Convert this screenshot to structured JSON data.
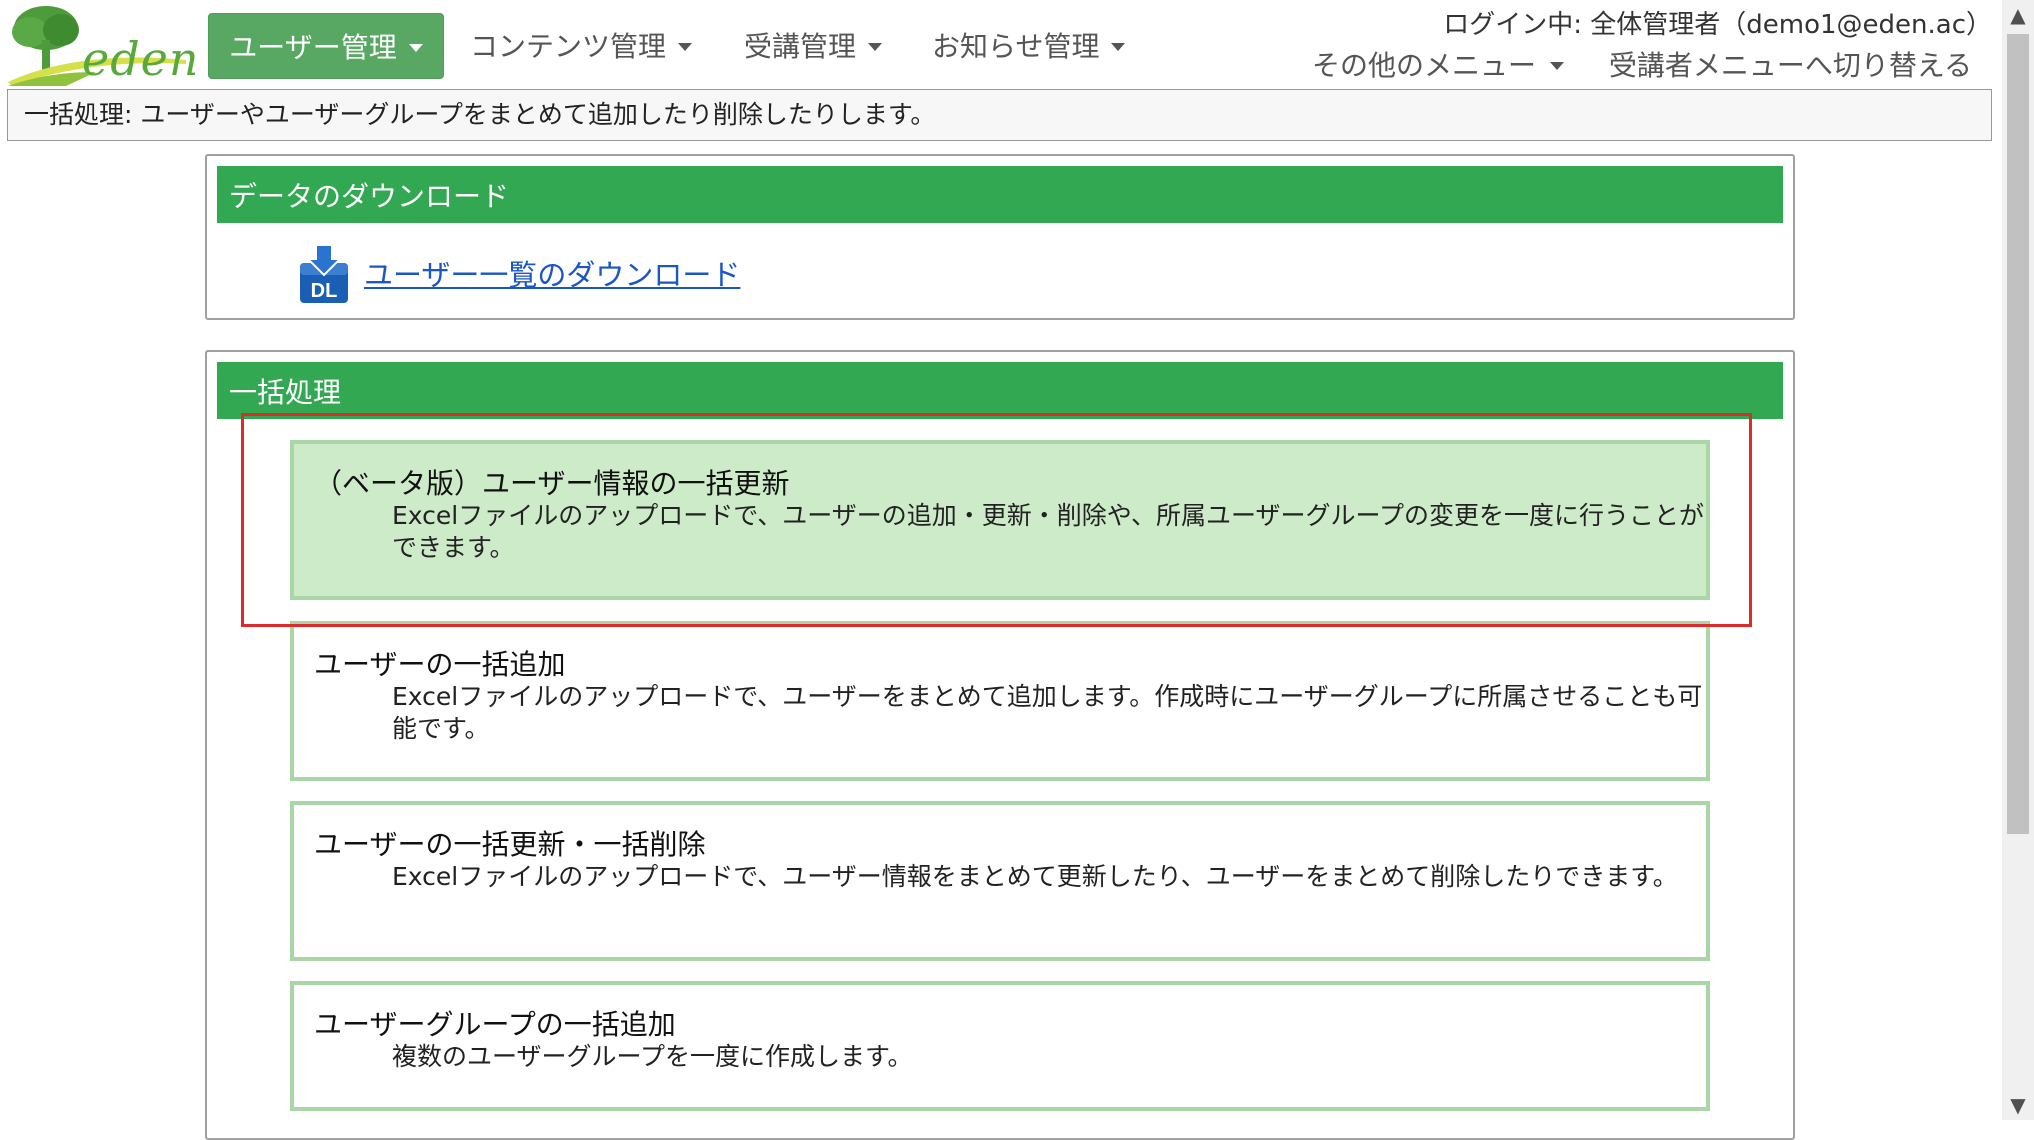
{
  "header": {
    "logo_text": "eden",
    "nav": [
      {
        "label": "ユーザー管理"
      },
      {
        "label": "コンテンツ管理"
      },
      {
        "label": "受講管理"
      },
      {
        "label": "お知らせ管理"
      }
    ],
    "login_info": "ログイン中: 全体管理者（demo1@eden.ac）",
    "other_menu": "その他のメニュー",
    "switch_link": "受講者メニューへ切り替える"
  },
  "description": "一括処理: ユーザーやユーザーグループをまとめて追加したり削除したりします。",
  "download_panel": {
    "title": "データのダウンロード",
    "icon_label": "DL",
    "link": "ユーザー一覧のダウンロード"
  },
  "batch_panel": {
    "title": "一括処理",
    "items": [
      {
        "title": "（ベータ版）ユーザー情報の一括更新",
        "desc": "Excelファイルのアップロードで、ユーザーの追加・更新・削除や、所属ユーザーグループの変更を一度に行うことができます。"
      },
      {
        "title": "ユーザーの一括追加",
        "desc": "Excelファイルのアップロードで、ユーザーをまとめて追加します。作成時にユーザーグループに所属させることも可能です。"
      },
      {
        "title": "ユーザーの一括更新・一括削除",
        "desc": "Excelファイルのアップロードで、ユーザー情報をまとめて更新したり、ユーザーをまとめて削除したりできます。"
      },
      {
        "title": "ユーザーグループの一括追加",
        "desc": "複数のユーザーグループを一度に作成します。"
      }
    ]
  },
  "colors": {
    "accent_green": "#33a852",
    "nav_active": "#58a863",
    "item_border": "#a9d6a6",
    "item_highlight": "#cdebc9",
    "highlight_box": "#dd2b2b",
    "link": "#1a56c4"
  }
}
